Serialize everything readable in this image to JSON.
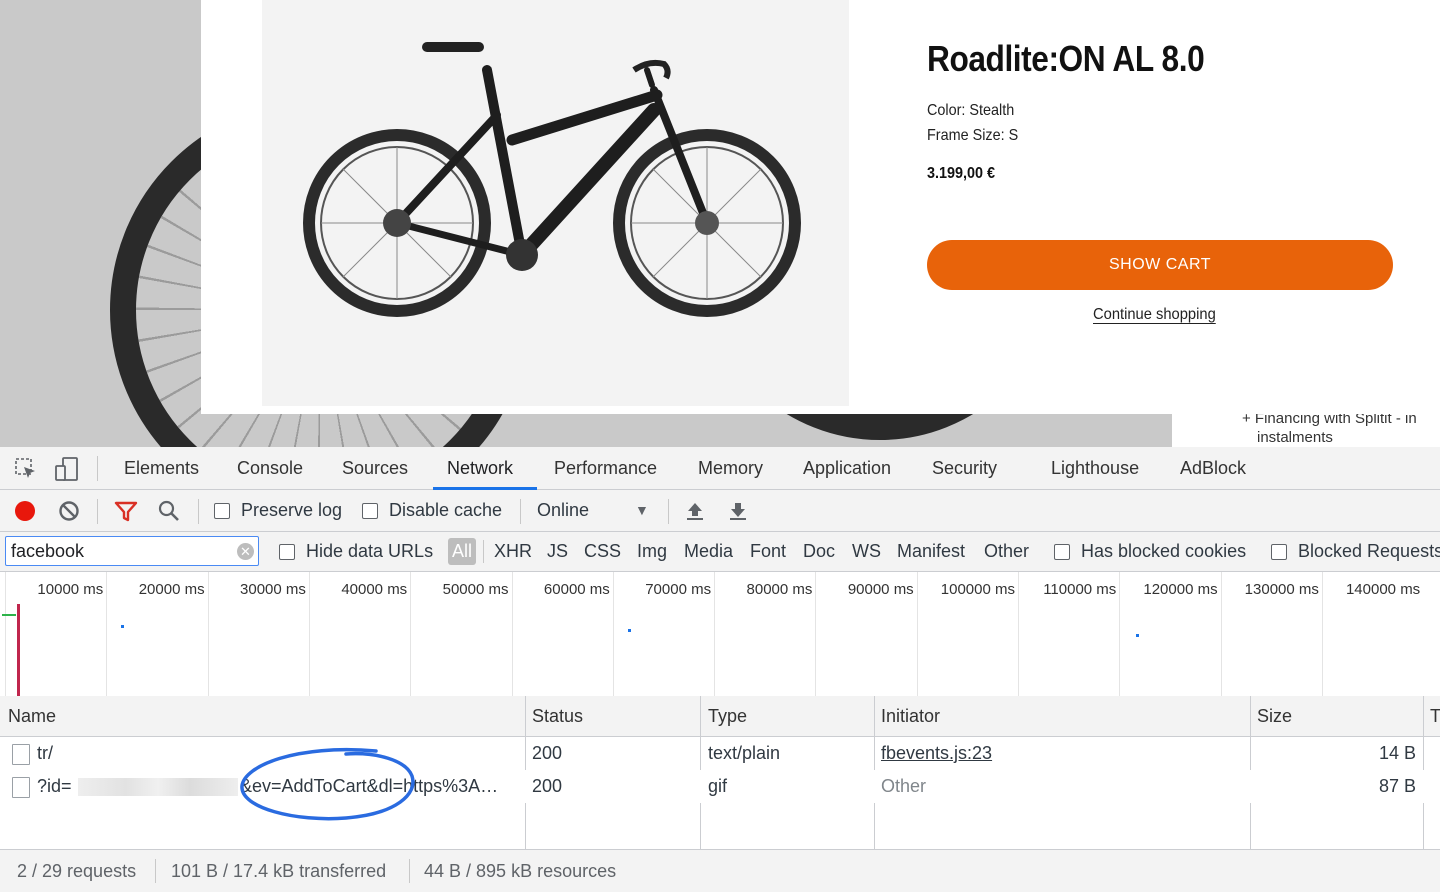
{
  "product": {
    "title": "Roadlite:ON AL 8.0",
    "color": "Color: Stealth",
    "frame_size": "Frame Size: S",
    "price": "3.199,00 €",
    "show_cart_label": "SHOW CART",
    "continue_label": "Continue shopping",
    "financing_line1": "+ Financing with Splitit - in",
    "financing_line2": "instalments",
    "accent_color": "#e8630a"
  },
  "devtools": {
    "tabs": [
      "Elements",
      "Console",
      "Sources",
      "Network",
      "Performance",
      "Memory",
      "Application",
      "Security",
      "Lighthouse",
      "AdBlock"
    ],
    "active_tab": "Network",
    "toolbar": {
      "preserve_log": "Preserve log",
      "disable_cache": "Disable cache",
      "throttling": "Online"
    },
    "filter": {
      "value": "facebook",
      "hide_data_urls": "Hide data URLs",
      "types": [
        "All",
        "XHR",
        "JS",
        "CSS",
        "Img",
        "Media",
        "Font",
        "Doc",
        "WS",
        "Manifest",
        "Other"
      ],
      "active_type": "All",
      "has_blocked_cookies": "Has blocked cookies",
      "blocked_requests": "Blocked Requests"
    },
    "timeline_ticks": [
      "10000 ms",
      "20000 ms",
      "30000 ms",
      "40000 ms",
      "50000 ms",
      "60000 ms",
      "70000 ms",
      "80000 ms",
      "90000 ms",
      "100000 ms",
      "110000 ms",
      "120000 ms",
      "130000 ms",
      "140000 ms"
    ],
    "columns": {
      "name": "Name",
      "status": "Status",
      "type": "Type",
      "initiator": "Initiator",
      "size": "Size",
      "time": "T"
    },
    "rows": [
      {
        "name": "tr/",
        "status": "200",
        "type": "text/plain",
        "initiator": "fbevents.js:23",
        "size": "14 B"
      },
      {
        "name_prefix": "?id=",
        "name_suffix": "&ev=AddToCart&dl=https%3A…",
        "status": "200",
        "type": "gif",
        "initiator": "Other",
        "size": "87 B"
      }
    ],
    "status": {
      "requests": "2 / 29 requests",
      "transferred": "101 B / 17.4 kB transferred",
      "resources": "44 B / 895 kB resources"
    }
  }
}
